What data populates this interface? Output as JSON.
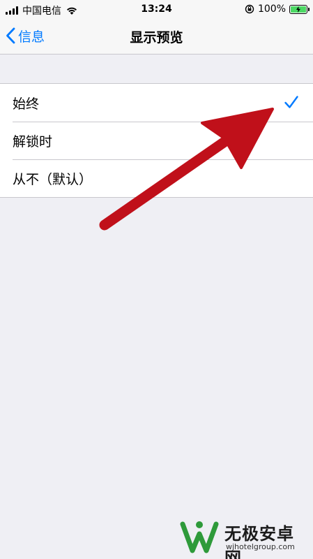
{
  "status_bar": {
    "carrier": "中国电信",
    "time": "13:24",
    "battery_percent": "100%",
    "battery_level": 1.0,
    "icons": [
      "signal-icon",
      "wifi-icon",
      "rotation-lock-icon",
      "battery-charging-icon"
    ]
  },
  "nav": {
    "back_label": "信息",
    "title": "显示预览"
  },
  "options": [
    {
      "label": "始终",
      "selected": true
    },
    {
      "label": "解锁时",
      "selected": false
    },
    {
      "label": "从不（默认）",
      "selected": false
    }
  ],
  "colors": {
    "accent": "#007aff",
    "background": "#efeff4",
    "annotation_arrow": "#c0101a",
    "battery_fill": "#4cd964"
  },
  "watermark": {
    "title": "无极安卓网",
    "url": "wjhotelgroup.com"
  }
}
